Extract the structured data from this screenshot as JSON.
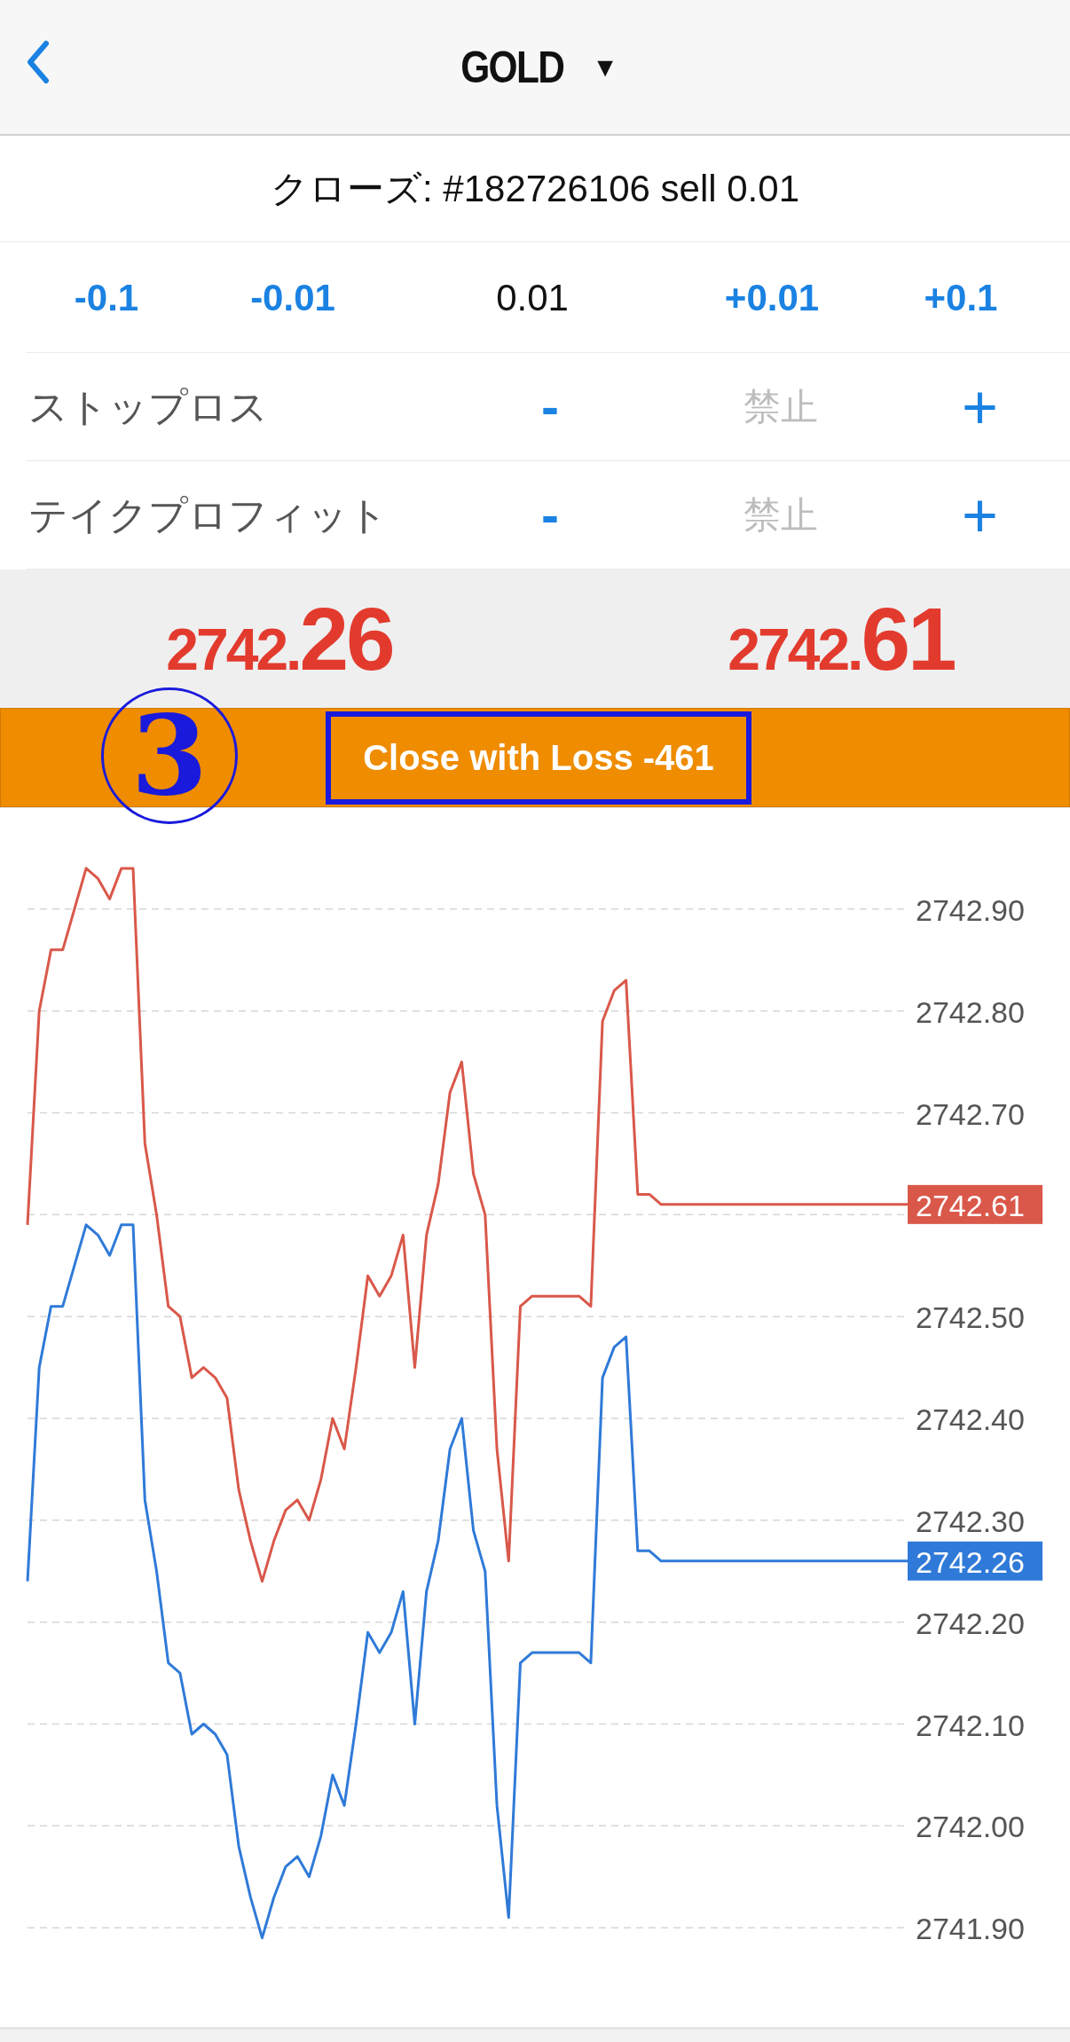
{
  "header": {
    "title": "GOLD",
    "dropdown_glyph": "▼"
  },
  "order_title": "クローズ: #182726106 sell 0.01",
  "volume": [
    {
      "label": "-0.1",
      "kind": "step"
    },
    {
      "label": "-0.01",
      "kind": "step"
    },
    {
      "label": "0.01",
      "kind": "value"
    },
    {
      "label": "+0.01",
      "kind": "step"
    },
    {
      "label": "+0.1",
      "kind": "step"
    }
  ],
  "levels": [
    {
      "label": "ストップロス",
      "minus": "-",
      "value": "禁止",
      "plus": "+",
      "disabled": true
    },
    {
      "label": "テイクプロフィット",
      "minus": "-",
      "value": "禁止",
      "plus": "+",
      "disabled": true
    }
  ],
  "prices": [
    {
      "kind": "bid",
      "main": "2742.",
      "big": "26"
    },
    {
      "kind": "ask",
      "main": "2742.",
      "big": "61"
    }
  ],
  "close_button": {
    "label": "Close with Loss -461",
    "highlighted": true
  },
  "annotation": {
    "number": "3"
  },
  "chart": {
    "chart_data": {
      "type": "line",
      "grid": true,
      "ylim": [
        2741.8,
        2743.0
      ],
      "yticks": [
        {
          "value": 2742.9,
          "label": "2742.90"
        },
        {
          "value": 2742.8,
          "label": "2742.80"
        },
        {
          "value": 2742.7,
          "label": "2742.70"
        },
        {
          "value": 2742.5,
          "label": "2742.50"
        },
        {
          "value": 2742.4,
          "label": "2742.40"
        },
        {
          "value": 2742.3,
          "label": "2742.30"
        },
        {
          "value": 2742.2,
          "label": "2742.20"
        },
        {
          "value": 2742.1,
          "label": "2742.10"
        },
        {
          "value": 2742.0,
          "label": "2742.00"
        },
        {
          "value": 2741.9,
          "label": "2741.90"
        }
      ],
      "categories": [
        null,
        null,
        null,
        null,
        null,
        null,
        null,
        null,
        null,
        null,
        null,
        null,
        null,
        null,
        null,
        null,
        null,
        null,
        null,
        null,
        null,
        null,
        null,
        null,
        null,
        null,
        null,
        null,
        null,
        null,
        null,
        null,
        null,
        null,
        null,
        null,
        null,
        null,
        null,
        null,
        null,
        null,
        null,
        null,
        null,
        null,
        null,
        null,
        null,
        null,
        null,
        null,
        null,
        null,
        null,
        null,
        null,
        null,
        null,
        null,
        null,
        null,
        null,
        null,
        null,
        null,
        null,
        null,
        null,
        null,
        null,
        null,
        null,
        null,
        null,
        null
      ],
      "series": [
        {
          "color": "#d9584a",
          "values": [
            2742.59,
            2742.8,
            2742.86,
            2742.86,
            2742.9,
            2742.94,
            2742.93,
            2742.91,
            2742.94,
            2742.94,
            2742.67,
            2742.6,
            2742.51,
            2742.5,
            2742.44,
            2742.45,
            2742.44,
            2742.42,
            2742.33,
            2742.28,
            2742.24,
            2742.28,
            2742.31,
            2742.32,
            2742.3,
            2742.34,
            2742.4,
            2742.37,
            2742.45,
            2742.54,
            2742.52,
            2742.54,
            2742.58,
            2742.45,
            2742.58,
            2742.63,
            2742.72,
            2742.75,
            2742.64,
            2742.6,
            2742.37,
            2742.26,
            2742.51,
            2742.52,
            2742.52,
            2742.52,
            2742.52,
            2742.52,
            2742.51,
            2742.79,
            2742.82,
            2742.83,
            2742.62,
            2742.62,
            2742.61,
            2742.61,
            2742.61,
            2742.61,
            2742.61,
            2742.61,
            2742.61,
            2742.61,
            2742.61,
            2742.61,
            2742.61,
            2742.61,
            2742.61,
            2742.61,
            2742.61,
            2742.61,
            2742.61,
            2742.61,
            2742.61,
            2742.61,
            2742.61,
            2742.61
          ]
        },
        {
          "color": "#2f7ad8",
          "values": [
            2742.24,
            2742.45,
            2742.51,
            2742.51,
            2742.55,
            2742.59,
            2742.58,
            2742.56,
            2742.59,
            2742.59,
            2742.32,
            2742.25,
            2742.16,
            2742.15,
            2742.09,
            2742.1,
            2742.09,
            2742.07,
            2741.98,
            2741.93,
            2741.89,
            2741.93,
            2741.96,
            2741.97,
            2741.95,
            2741.99,
            2742.05,
            2742.02,
            2742.1,
            2742.19,
            2742.17,
            2742.19,
            2742.23,
            2742.1,
            2742.23,
            2742.28,
            2742.37,
            2742.4,
            2742.29,
            2742.25,
            2742.02,
            2741.91,
            2742.16,
            2742.17,
            2742.17,
            2742.17,
            2742.17,
            2742.17,
            2742.16,
            2742.44,
            2742.47,
            2742.48,
            2742.27,
            2742.27,
            2742.26,
            2742.26,
            2742.26,
            2742.26,
            2742.26,
            2742.26,
            2742.26,
            2742.26,
            2742.26,
            2742.26,
            2742.26,
            2742.26,
            2742.26,
            2742.26,
            2742.26,
            2742.26,
            2742.26,
            2742.26,
            2742.26,
            2742.26,
            2742.26,
            2742.26
          ]
        }
      ]
    },
    "price_tags": [
      {
        "label": "2742.61",
        "color": "#d9584a"
      },
      {
        "label": "2742.26",
        "color": "#2f7ad8"
      }
    ]
  }
}
